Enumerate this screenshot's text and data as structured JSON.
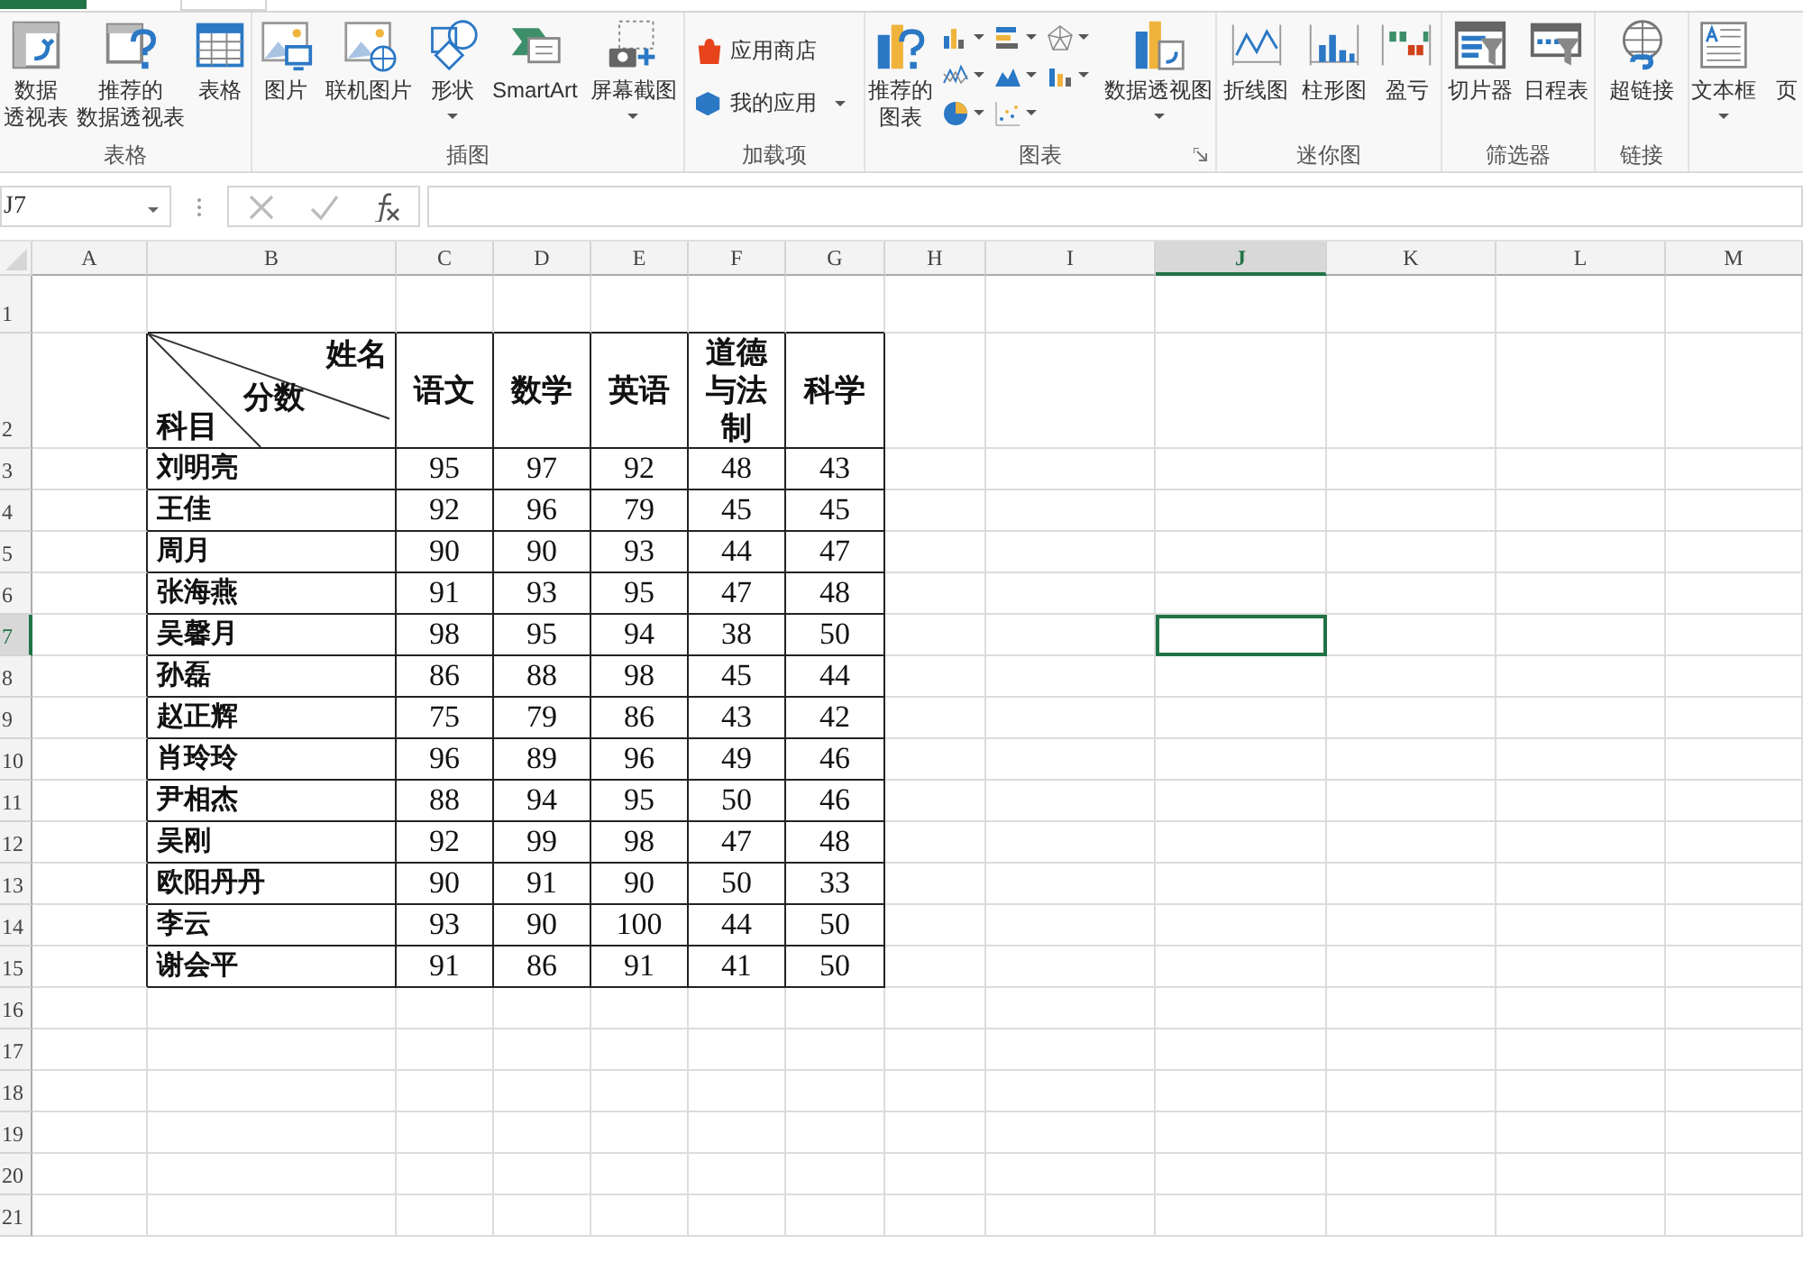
{
  "ribbon": {
    "groups": [
      {
        "label": "表格",
        "launcher": false,
        "items": [
          {
            "kind": "large",
            "lines": [
              "数据",
              "透视表"
            ],
            "dropdown": false
          },
          {
            "kind": "large",
            "lines": [
              "推荐的",
              "数据透视表"
            ],
            "dropdown": false
          },
          {
            "kind": "large",
            "lines": [
              "表格"
            ],
            "dropdown": false
          }
        ]
      },
      {
        "label": "插图",
        "launcher": false,
        "items": [
          {
            "kind": "large",
            "lines": [
              "图片"
            ],
            "dropdown": false
          },
          {
            "kind": "large",
            "lines": [
              "联机图片"
            ],
            "dropdown": false
          },
          {
            "kind": "large",
            "lines": [
              "形状"
            ],
            "dropdown": true
          },
          {
            "kind": "large",
            "lines": [
              "SmartArt"
            ],
            "dropdown": false
          },
          {
            "kind": "large",
            "lines": [
              "屏幕截图"
            ],
            "dropdown": true
          }
        ]
      },
      {
        "label": "加载项",
        "launcher": false,
        "items": [
          {
            "kind": "list",
            "lines": [
              "应用商店"
            ],
            "dropdown": false
          },
          {
            "kind": "list",
            "lines": [
              "我的应用"
            ],
            "dropdown": true
          }
        ]
      },
      {
        "label": "图表",
        "launcher": true,
        "items": [
          {
            "kind": "large",
            "lines": [
              "推荐的",
              "图表"
            ],
            "dropdown": false
          },
          {
            "kind": "mini",
            "dropdown": true
          },
          {
            "kind": "mini",
            "dropdown": true
          },
          {
            "kind": "mini",
            "dropdown": true
          },
          {
            "kind": "mini",
            "dropdown": true
          },
          {
            "kind": "mini",
            "dropdown": true
          },
          {
            "kind": "mini",
            "dropdown": true
          },
          {
            "kind": "mini",
            "dropdown": true
          },
          {
            "kind": "mini",
            "dropdown": true
          },
          {
            "kind": "large",
            "lines": [
              "数据透视图"
            ],
            "dropdown": true
          }
        ]
      },
      {
        "label": "迷你图",
        "launcher": false,
        "items": [
          {
            "kind": "large",
            "lines": [
              "折线图"
            ],
            "dropdown": false
          },
          {
            "kind": "large",
            "lines": [
              "柱形图"
            ],
            "dropdown": false
          },
          {
            "kind": "large",
            "lines": [
              "盈亏"
            ],
            "dropdown": false
          }
        ]
      },
      {
        "label": "筛选器",
        "launcher": false,
        "items": [
          {
            "kind": "large",
            "lines": [
              "切片器"
            ],
            "dropdown": false
          },
          {
            "kind": "large",
            "lines": [
              "日程表"
            ],
            "dropdown": false
          }
        ]
      },
      {
        "label": "链接",
        "launcher": false,
        "items": [
          {
            "kind": "large",
            "lines": [
              "超链接"
            ],
            "dropdown": false
          }
        ]
      },
      {
        "items": [
          {
            "kind": "large",
            "lines": [
              "文本框"
            ],
            "dropdown": true
          },
          {
            "kind": "text",
            "lines": [
              "页"
            ]
          }
        ]
      }
    ]
  },
  "name_box": {
    "value": "J7"
  },
  "columns": [
    {
      "label": "A",
      "selected": false
    },
    {
      "label": "B",
      "selected": false
    },
    {
      "label": "C",
      "selected": false
    },
    {
      "label": "D",
      "selected": false
    },
    {
      "label": "E",
      "selected": false
    },
    {
      "label": "F",
      "selected": false
    },
    {
      "label": "G",
      "selected": false
    },
    {
      "label": "H",
      "selected": false
    },
    {
      "label": "I",
      "selected": false
    },
    {
      "label": "J",
      "selected": true
    },
    {
      "label": "K",
      "selected": false
    },
    {
      "label": "L",
      "selected": false
    },
    {
      "label": "M",
      "selected": false
    }
  ],
  "rows": [
    {
      "label": "1",
      "selected": false
    },
    {
      "label": "2",
      "selected": false
    },
    {
      "label": "3",
      "selected": false
    },
    {
      "label": "4",
      "selected": false
    },
    {
      "label": "5",
      "selected": false
    },
    {
      "label": "6",
      "selected": false
    },
    {
      "label": "7",
      "selected": true
    },
    {
      "label": "8",
      "selected": false
    },
    {
      "label": "9",
      "selected": false
    },
    {
      "label": "10",
      "selected": false
    },
    {
      "label": "11",
      "selected": false
    },
    {
      "label": "12",
      "selected": false
    },
    {
      "label": "13",
      "selected": false
    },
    {
      "label": "14",
      "selected": false
    },
    {
      "label": "15",
      "selected": false
    },
    {
      "label": "16",
      "selected": false
    },
    {
      "label": "17",
      "selected": false
    },
    {
      "label": "18",
      "selected": false
    },
    {
      "label": "19",
      "selected": false
    },
    {
      "label": "20",
      "selected": false
    },
    {
      "label": "21",
      "selected": false
    }
  ],
  "table": {
    "corner": {
      "top": "姓名",
      "middle": "分数",
      "bottom": "科目"
    },
    "subjects": [
      "语文",
      "数学",
      "英语",
      "道德与法制",
      "科学"
    ],
    "rows": [
      {
        "name": "刘明亮",
        "scores": [
          "95",
          "97",
          "92",
          "48",
          "43"
        ]
      },
      {
        "name": "王佳",
        "scores": [
          "92",
          "96",
          "79",
          "45",
          "45"
        ]
      },
      {
        "name": "周月",
        "scores": [
          "90",
          "90",
          "93",
          "44",
          "47"
        ]
      },
      {
        "name": "张海燕",
        "scores": [
          "91",
          "93",
          "95",
          "47",
          "48"
        ]
      },
      {
        "name": "吴馨月",
        "scores": [
          "98",
          "95",
          "94",
          "38",
          "50"
        ]
      },
      {
        "name": "孙磊",
        "scores": [
          "86",
          "88",
          "98",
          "45",
          "44"
        ]
      },
      {
        "name": "赵正辉",
        "scores": [
          "75",
          "79",
          "86",
          "43",
          "42"
        ]
      },
      {
        "name": "肖玲玲",
        "scores": [
          "96",
          "89",
          "96",
          "49",
          "46"
        ]
      },
      {
        "name": "尹相杰",
        "scores": [
          "88",
          "94",
          "95",
          "50",
          "46"
        ]
      },
      {
        "name": "吴刚",
        "scores": [
          "92",
          "99",
          "98",
          "47",
          "48"
        ]
      },
      {
        "name": "欧阳丹丹",
        "scores": [
          "90",
          "91",
          "90",
          "50",
          "33"
        ]
      },
      {
        "name": "李云",
        "scores": [
          "93",
          "90",
          "100",
          "44",
          "50"
        ]
      },
      {
        "name": "谢会平",
        "scores": [
          "91",
          "86",
          "91",
          "41",
          "50"
        ]
      }
    ]
  }
}
